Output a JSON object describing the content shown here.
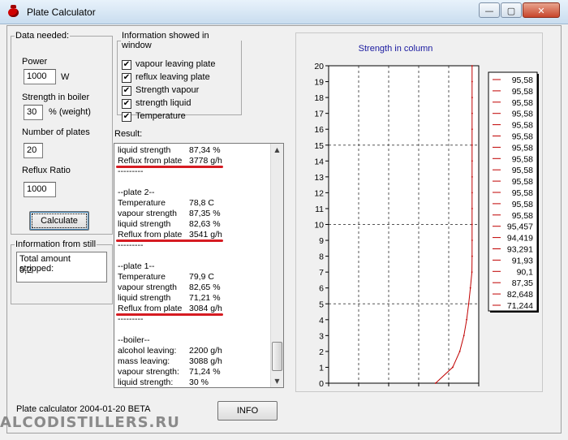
{
  "window": {
    "title": "Plate Calculator",
    "min_glyph": "—",
    "max_glyph": "▢",
    "close_glyph": "✕"
  },
  "data_needed": {
    "legend": "Data needed:",
    "power_label": "Power",
    "power_value": "1000",
    "power_unit": "W",
    "strength_label": "Strength in  boiler",
    "strength_value": "30",
    "strength_unit": "% (weight)",
    "plates_label": "Number of plates",
    "plates_value": "20",
    "reflux_label": "Reflux Ratio",
    "reflux_value": "1000",
    "calculate_label": "Calculate"
  },
  "info_window": {
    "legend": "Information showed in window",
    "check_glyph": "✔",
    "options": [
      {
        "label": "vapour leaving plate",
        "checked": true
      },
      {
        "label": "reflux leaving plate",
        "checked": true
      },
      {
        "label": "Strength vapour",
        "checked": true
      },
      {
        "label": "strength liquid",
        "checked": true
      },
      {
        "label": "Temperature",
        "checked": true
      }
    ]
  },
  "still": {
    "legend": "Information from still",
    "line1": "Total amount stripped:",
    "line2": "0,2"
  },
  "result": {
    "label": "Result:",
    "up_glyph": "▲",
    "down_glyph": "▼",
    "lines": [
      {
        "label": "liquid strength",
        "value": "87,34 %",
        "underline": false
      },
      {
        "label": "Reflux from plate",
        "value": "3778 g/h",
        "underline": true
      },
      {
        "label": "---------",
        "value": "",
        "underline": false
      },
      {
        "label": "",
        "value": "",
        "underline": false
      },
      {
        "label": "--plate 2--",
        "value": "",
        "underline": false
      },
      {
        "label": "Temperature",
        "value": "78,8  C",
        "underline": false
      },
      {
        "label": "vapour strength",
        "value": "87,35 %",
        "underline": false
      },
      {
        "label": "liquid strength",
        "value": "82,63 %",
        "underline": false
      },
      {
        "label": "Reflux from plate",
        "value": "3541 g/h",
        "underline": true
      },
      {
        "label": "---------",
        "value": "",
        "underline": false
      },
      {
        "label": "",
        "value": "",
        "underline": false
      },
      {
        "label": "--plate 1--",
        "value": "",
        "underline": false
      },
      {
        "label": "Temperature",
        "value": "79,9  C",
        "underline": false
      },
      {
        "label": "vapour strength",
        "value": "82,65 %",
        "underline": false
      },
      {
        "label": "liquid strength",
        "value": "71,21 %",
        "underline": false
      },
      {
        "label": "Reflux from plate",
        "value": "3084 g/h",
        "underline": true
      },
      {
        "label": "---------",
        "value": "",
        "underline": false
      },
      {
        "label": "",
        "value": "",
        "underline": false
      },
      {
        "label": "--boiler--",
        "value": "",
        "underline": false
      },
      {
        "label": "alcohol leaving:",
        "value": "2200 g/h",
        "underline": false
      },
      {
        "label": "mass leaving:",
        "value": "3088 g/h",
        "underline": false
      },
      {
        "label": "vapour strength:",
        "value": "71,24 %",
        "underline": false
      },
      {
        "label": "liquid strength:",
        "value": "30 %",
        "underline": false
      }
    ]
  },
  "status_text": "Plate calculator 2004-01-20 BETA",
  "info_button": "INFO",
  "watermark": "ALCODISTILLERS.RU",
  "chart_data": {
    "type": "line",
    "title": "Strength in column",
    "xlabel": "",
    "ylabel": "",
    "xlim": [
      0,
      100
    ],
    "ylim": [
      0,
      20
    ],
    "xticks": [
      "0",
      "20",
      "40",
      "60",
      "80",
      "100"
    ],
    "yticks": [
      "0",
      "1",
      "2",
      "3",
      "4",
      "5",
      "6",
      "7",
      "8",
      "9",
      "10",
      "11",
      "12",
      "13",
      "14",
      "15",
      "16",
      "17",
      "18",
      "19",
      "20"
    ],
    "grid": true,
    "legend_position": "right",
    "line_color": "#c00000",
    "series": [
      {
        "x": [
          71.244,
          82.648,
          87.35,
          90.1,
          91.93,
          93.291,
          94.419,
          95.457,
          95.58,
          95.58,
          95.58,
          95.58,
          95.58,
          95.58,
          95.58,
          95.58,
          95.58,
          95.58,
          95.58,
          95.58,
          95.58
        ],
        "y": [
          0,
          1,
          2,
          3,
          4,
          5,
          6,
          7,
          8,
          9,
          10,
          11,
          12,
          13,
          14,
          15,
          16,
          17,
          18,
          19,
          20
        ]
      }
    ],
    "legend_entries": [
      "95,58",
      "95,58",
      "95,58",
      "95,58",
      "95,58",
      "95,58",
      "95,58",
      "95,58",
      "95,58",
      "95,58",
      "95,58",
      "95,58",
      "95,58",
      "95,457",
      "94,419",
      "93,291",
      "91,93",
      "90,1",
      "87,35",
      "82,648",
      "71,244"
    ]
  }
}
